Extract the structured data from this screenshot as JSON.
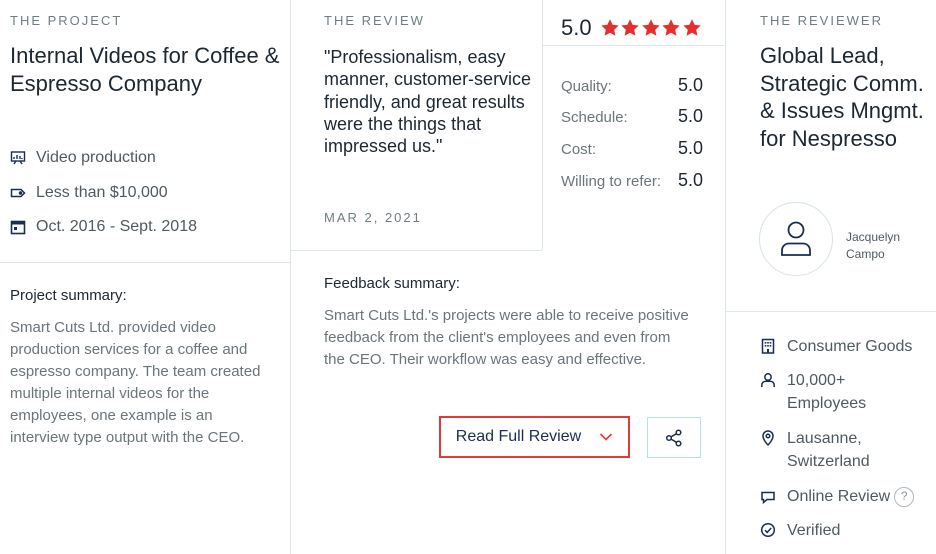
{
  "project": {
    "eyebrow": "THE PROJECT",
    "title": "Internal Videos for Coffee & Espresso Company",
    "service": "Video production",
    "budget": "Less than $10,000",
    "dates": "Oct. 2016 - Sept. 2018",
    "summary_label": "Project summary:",
    "summary": "Smart Cuts Ltd. provided video production services for a coffee and espresso company. The team created multiple internal videos for the employees, one example is an interview type output with the CEO."
  },
  "review": {
    "eyebrow": "THE REVIEW",
    "quote": "\"Professionalism, easy manner, customer-service friendly, and great results were the things that impressed us.\"",
    "date": "MAR 2, 2021",
    "overall": "5.0",
    "stars": 5,
    "star_color": "#e62e2e",
    "ratings": [
      {
        "label": "Quality:",
        "value": "5.0"
      },
      {
        "label": "Schedule:",
        "value": "5.0"
      },
      {
        "label": "Cost:",
        "value": "5.0"
      },
      {
        "label": "Willing to refer:",
        "value": "5.0"
      }
    ],
    "feedback_label": "Feedback summary:",
    "feedback": "Smart Cuts Ltd.'s projects were able to receive positive feedback from the client's employees and even from the CEO. Their workflow was easy and effective.",
    "read_button": "Read Full Review",
    "accent_color": "#e53935"
  },
  "reviewer": {
    "eyebrow": "THE REVIEWER",
    "title": "Global Lead, Strategic Comm. & Issues Mngmt. for Nespresso",
    "name": "Jacquelyn Campo",
    "industry": "Consumer Goods",
    "employees": "10,000+ Employees",
    "location": "Lausanne, Switzerland",
    "review_type": "Online Review",
    "help": "?",
    "verified": "Verified"
  },
  "icons": [
    "video-production-icon",
    "budget-tag-icon",
    "calendar-icon",
    "star-icon",
    "chevron-down-icon",
    "share-icon",
    "user-icon",
    "building-icon",
    "person-icon",
    "location-pin-icon",
    "chat-bubble-icon",
    "verified-check-icon"
  ]
}
